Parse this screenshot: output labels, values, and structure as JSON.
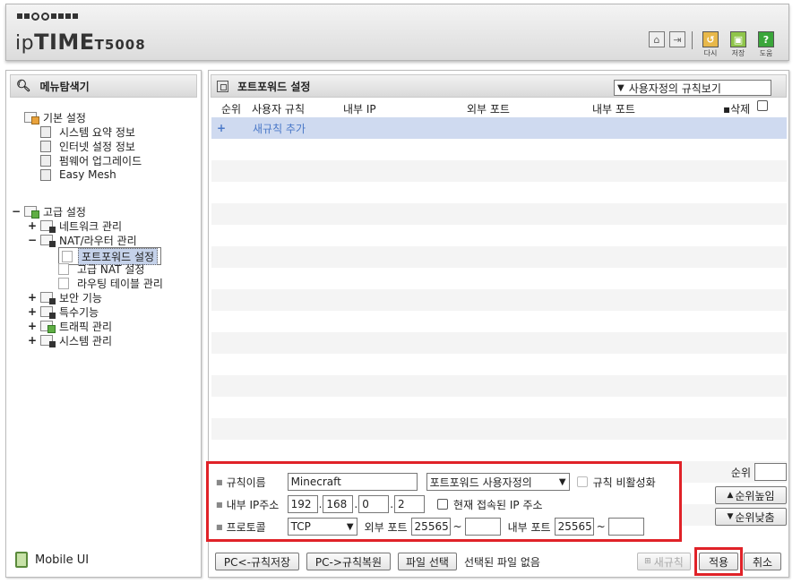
{
  "header": {
    "brand_a": "ip",
    "brand_b": "TIME",
    "model": "T5008",
    "buttons": [
      {
        "label": "다시",
        "icon": "refresh-icon",
        "color": "#e8b84a"
      },
      {
        "label": "저장",
        "icon": "save-icon",
        "color": "#8fc54a"
      },
      {
        "label": "도움",
        "icon": "help-icon",
        "color": "#3aa63a",
        "glyph": "?"
      }
    ]
  },
  "sidebar": {
    "title": "메뉴탐색기",
    "basic": {
      "label": "기본 설정",
      "items": [
        "시스템 요약 정보",
        "인터넷 설정 정보",
        "펌웨어 업그레이드",
        "Easy Mesh"
      ]
    },
    "advanced": {
      "toggle": "−",
      "label": "고급 설정",
      "network": {
        "toggle": "+",
        "label": "네트워크 관리"
      },
      "nat": {
        "toggle": "−",
        "label": "NAT/라우터 관리",
        "items": [
          "포트포워드 설정",
          "고급 NAT 설정",
          "라우팅 테이블 관리"
        ],
        "selected": "포트포워드 설정"
      },
      "others": [
        {
          "toggle": "+",
          "label": "보안 기능"
        },
        {
          "toggle": "+",
          "label": "특수기능"
        },
        {
          "toggle": "+",
          "label": "트래픽 관리"
        },
        {
          "toggle": "+",
          "label": "시스템 관리"
        }
      ]
    },
    "mobile": "Mobile UI"
  },
  "main": {
    "title": "포트포워드 설정",
    "view_select": "사용자정의 규칙보기",
    "columns": {
      "order": "순위",
      "rule": "사용자 규칙",
      "internal_ip": "내부 IP",
      "external_port": "외부 포트",
      "internal_port": "내부 포트",
      "delete": "삭제"
    },
    "add_row": {
      "plus": "+",
      "label": "새규칙 추가"
    }
  },
  "form": {
    "rule_name_label": "규칙이름",
    "rule_name_value": "Minecraft",
    "rule_type": "포트포워드 사용자정의",
    "disable_label": "규칙 비활성화",
    "ip_label": "내부 IP주소",
    "ip": [
      "192",
      "168",
      "0",
      "2"
    ],
    "current_ip_label": "현재 접속된 IP 주소",
    "protocol_label": "프로토콜",
    "protocol": "TCP",
    "ext_port_label": "외부 포트",
    "ext_port_from": "25565",
    "ext_port_to": "",
    "int_port_label": "내부 포트",
    "int_port_from": "25565",
    "int_port_to": "",
    "tilde": "~",
    "dot": "."
  },
  "side": {
    "order_label": "순위",
    "order_value": "",
    "up": "순위높임",
    "down": "순위낮춤"
  },
  "bottom": {
    "save_pc": "PC<-규칙저장",
    "restore_pc": "PC->규칙복원",
    "file_select": "파일 선택",
    "no_file": "선택된 파일 없음",
    "new_rule": "새규칙",
    "apply": "적용",
    "cancel": "취소"
  },
  "colors": {
    "highlight_red": "#e02228",
    "add_row_bg": "#cfdaf0",
    "add_row_text": "#4a78c8",
    "selected_bg": "#c5d2ea"
  }
}
